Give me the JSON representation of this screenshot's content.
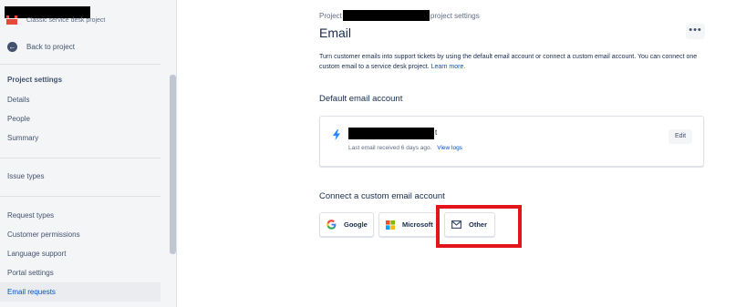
{
  "sidebar": {
    "project_type": "Classic service desk project",
    "back_label": "Back to project",
    "section_title": "Project settings",
    "items": [
      {
        "label": "Details"
      },
      {
        "label": "People"
      },
      {
        "label": "Summary"
      },
      {
        "label": "Issue types"
      },
      {
        "label": "Request types"
      },
      {
        "label": "Customer permissions"
      },
      {
        "label": "Language support"
      },
      {
        "label": "Portal settings"
      },
      {
        "label": "Email requests",
        "active": true
      }
    ]
  },
  "header": {
    "breadcrumb_start": "Project",
    "breadcrumb_end": "project settings",
    "title": "Email",
    "more_label": "•••"
  },
  "main": {
    "description": "Turn customer emails into support tickets by using the default email account or connect a custom email account. You can connect one custom email to a service desk project.",
    "learn_more": "Learn more.",
    "default_heading": "Default email account",
    "default_account": {
      "address_tail": "t",
      "last_email": "Last email received 6 days ago.",
      "view_logs": "View logs",
      "edit_label": "Edit"
    },
    "custom_heading": "Connect a custom email account",
    "providers": [
      {
        "label": "Google",
        "icon": "google-icon"
      },
      {
        "label": "Microsoft",
        "icon": "microsoft-icon"
      },
      {
        "label": "Other",
        "icon": "envelope-icon"
      }
    ]
  },
  "colors": {
    "link": "#0052cc",
    "highlight": "#e2141c",
    "logo": "#e5493a"
  }
}
